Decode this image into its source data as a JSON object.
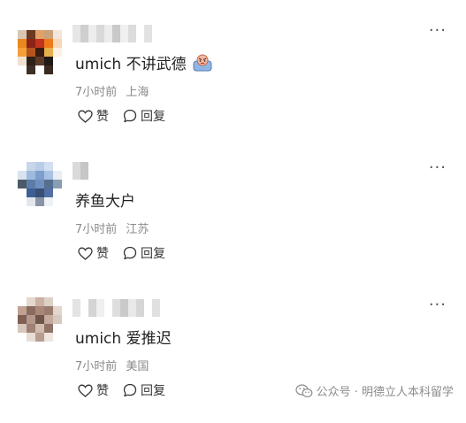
{
  "more_label": "···",
  "actions": {
    "like_label": "赞",
    "reply_label": "回复"
  },
  "comments": [
    {
      "text": "umich 不讲武德",
      "emoji": "rage-emoji",
      "time": "7小时前",
      "location": "上海"
    },
    {
      "text": "养鱼大户",
      "time": "7小时前",
      "location": "江苏"
    },
    {
      "text": "umich 爱推迟",
      "time": "7小时前",
      "location": "美国"
    }
  ],
  "watermark": "公众号 · 明德立人本科留学",
  "icons": {
    "like": "heart-icon",
    "reply": "speech-bubble-icon",
    "more": "more-icon",
    "watermark": "wechat-icon"
  }
}
